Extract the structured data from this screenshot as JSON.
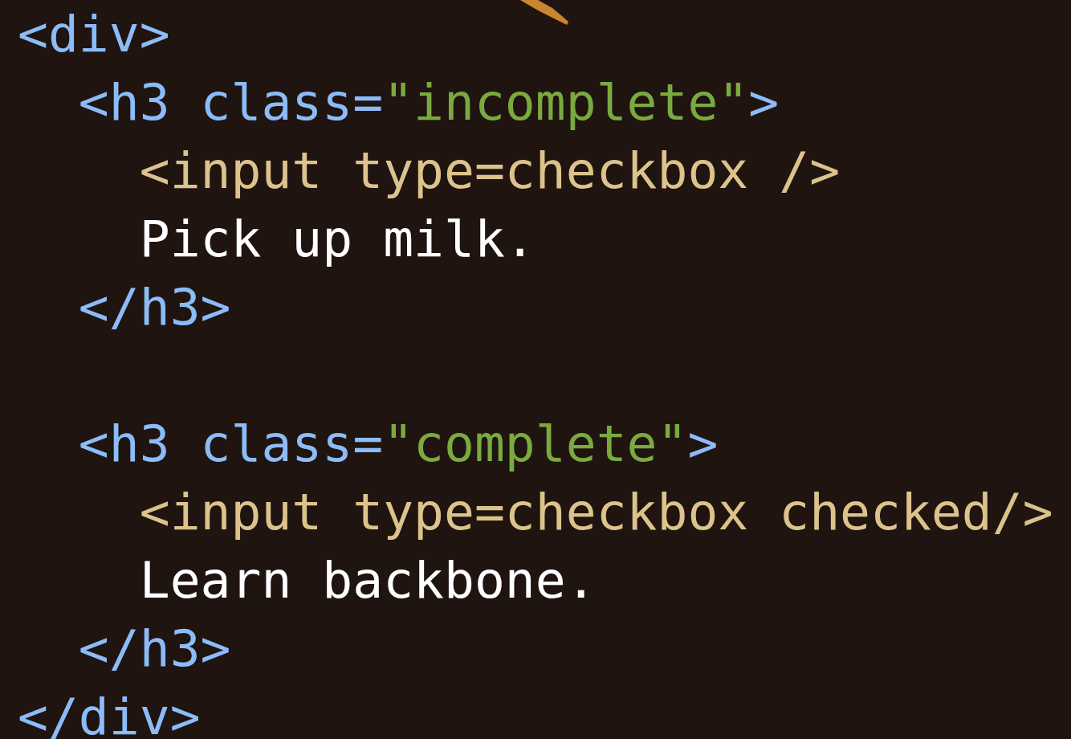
{
  "code_lines": [
    {
      "kind": "code",
      "tokens": [
        {
          "kind": "tag",
          "text": "<div>"
        }
      ]
    },
    {
      "kind": "code",
      "tokens": [
        {
          "kind": "tag",
          "text": "  <h3 class="
        },
        {
          "kind": "string",
          "text": "\"incomplete\""
        },
        {
          "kind": "tag",
          "text": ">"
        }
      ]
    },
    {
      "kind": "code",
      "tokens": [
        {
          "kind": "input",
          "text": "    <input type=checkbox />"
        }
      ]
    },
    {
      "kind": "code",
      "tokens": [
        {
          "kind": "text",
          "text": "    Pick up milk."
        }
      ]
    },
    {
      "kind": "code",
      "tokens": [
        {
          "kind": "tag",
          "text": "  </h3>"
        }
      ]
    },
    {
      "kind": "blank"
    },
    {
      "kind": "code",
      "tokens": [
        {
          "kind": "tag",
          "text": "  <h3 class="
        },
        {
          "kind": "string",
          "text": "\"complete\""
        },
        {
          "kind": "tag",
          "text": ">"
        }
      ]
    },
    {
      "kind": "code",
      "tokens": [
        {
          "kind": "input",
          "text": "    <input type=checkbox checked/>"
        }
      ]
    },
    {
      "kind": "code",
      "tokens": [
        {
          "kind": "text",
          "text": "    Learn backbone."
        }
      ]
    },
    {
      "kind": "code",
      "tokens": [
        {
          "kind": "tag",
          "text": "  </h3>"
        }
      ]
    },
    {
      "kind": "code",
      "tokens": [
        {
          "kind": "tag",
          "text": "</div>"
        }
      ]
    }
  ]
}
